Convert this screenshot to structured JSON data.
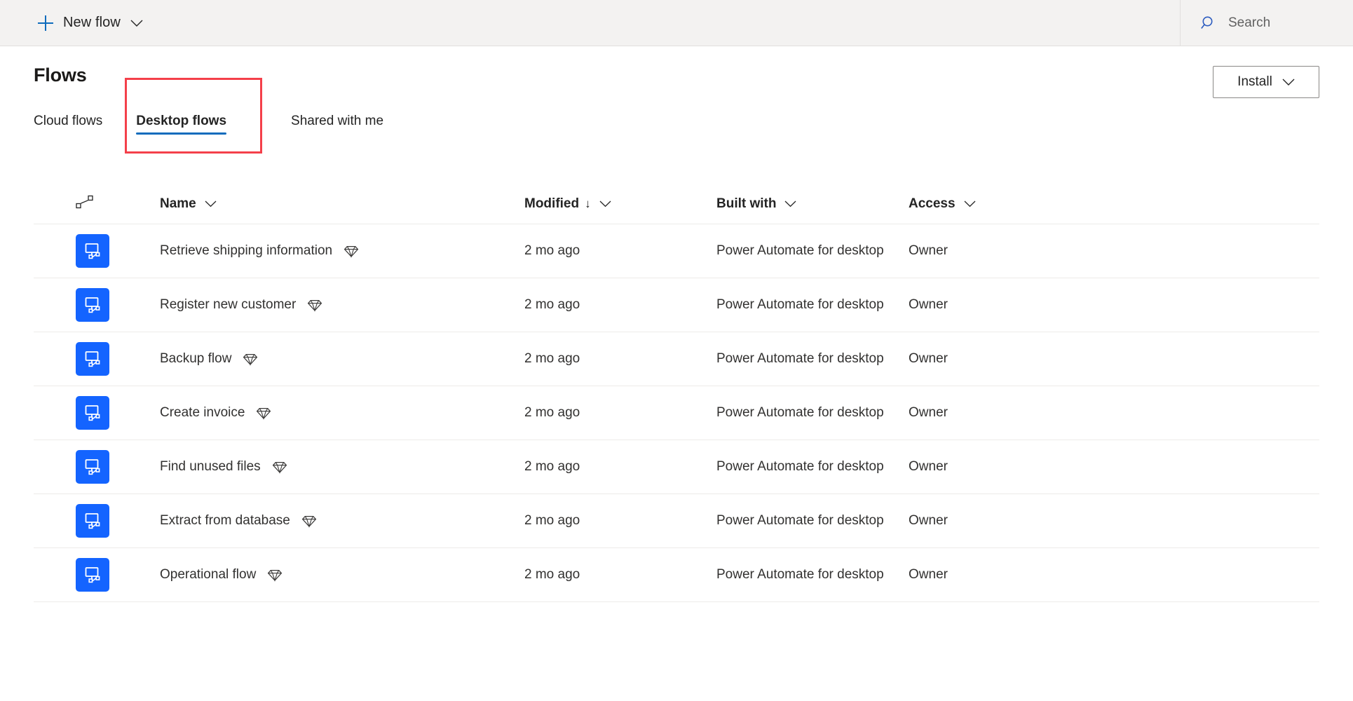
{
  "topbar": {
    "new_flow_label": "New flow",
    "new_flow_icon": "plus-icon",
    "new_flow_chevron": "chevron-down-icon",
    "search_placeholder": "Search",
    "search_icon": "search-icon"
  },
  "header": {
    "title": "Flows",
    "install_label": "Install",
    "install_chevron": "chevron-down-icon"
  },
  "tabs": [
    {
      "label": "Cloud flows",
      "active": false
    },
    {
      "label": "Desktop flows",
      "active": true
    },
    {
      "label": "Shared with me",
      "active": false
    }
  ],
  "annotation": {
    "highlight_color": "#f4404a",
    "target": "Desktop flows"
  },
  "table": {
    "columns": [
      {
        "label": "",
        "icon": "flow-connector-icon",
        "sorted": false
      },
      {
        "label": "Name",
        "sorted": false,
        "chevron": "chevron-down-icon"
      },
      {
        "label": "Modified",
        "sorted": true,
        "sort_direction": "↓",
        "chevron": "chevron-down-icon"
      },
      {
        "label": "Built with",
        "sorted": false,
        "chevron": "chevron-down-icon"
      },
      {
        "label": "Access",
        "sorted": false,
        "chevron": "chevron-down-icon"
      }
    ],
    "rows": [
      {
        "icon": "desktop-flow-icon",
        "name": "Retrieve shipping information",
        "premium": "premium-diamond-icon",
        "modified": "2 mo ago",
        "built_with": "Power Automate for desktop",
        "access": "Owner"
      },
      {
        "icon": "desktop-flow-icon",
        "name": "Register new customer",
        "premium": "premium-diamond-icon",
        "modified": "2 mo ago",
        "built_with": "Power Automate for desktop",
        "access": "Owner"
      },
      {
        "icon": "desktop-flow-icon",
        "name": "Backup flow",
        "premium": "premium-diamond-icon",
        "modified": "2 mo ago",
        "built_with": "Power Automate for desktop",
        "access": "Owner"
      },
      {
        "icon": "desktop-flow-icon",
        "name": "Create invoice",
        "premium": "premium-diamond-icon",
        "modified": "2 mo ago",
        "built_with": "Power Automate for desktop",
        "access": "Owner"
      },
      {
        "icon": "desktop-flow-icon",
        "name": "Find unused files",
        "premium": "premium-diamond-icon",
        "modified": "2 mo ago",
        "built_with": "Power Automate for desktop",
        "access": "Owner"
      },
      {
        "icon": "desktop-flow-icon",
        "name": "Extract from database",
        "premium": "premium-diamond-icon",
        "modified": "2 mo ago",
        "built_with": "Power Automate for desktop",
        "access": "Owner"
      },
      {
        "icon": "desktop-flow-icon",
        "name": "Operational flow",
        "premium": "premium-diamond-icon",
        "modified": "2 mo ago",
        "built_with": "Power Automate for desktop",
        "access": "Owner"
      }
    ]
  },
  "colors": {
    "accent": "#0f6cbd",
    "tile": "#1464ff",
    "toolbar_bg": "#f3f2f1",
    "annotation": "#f4404a"
  }
}
